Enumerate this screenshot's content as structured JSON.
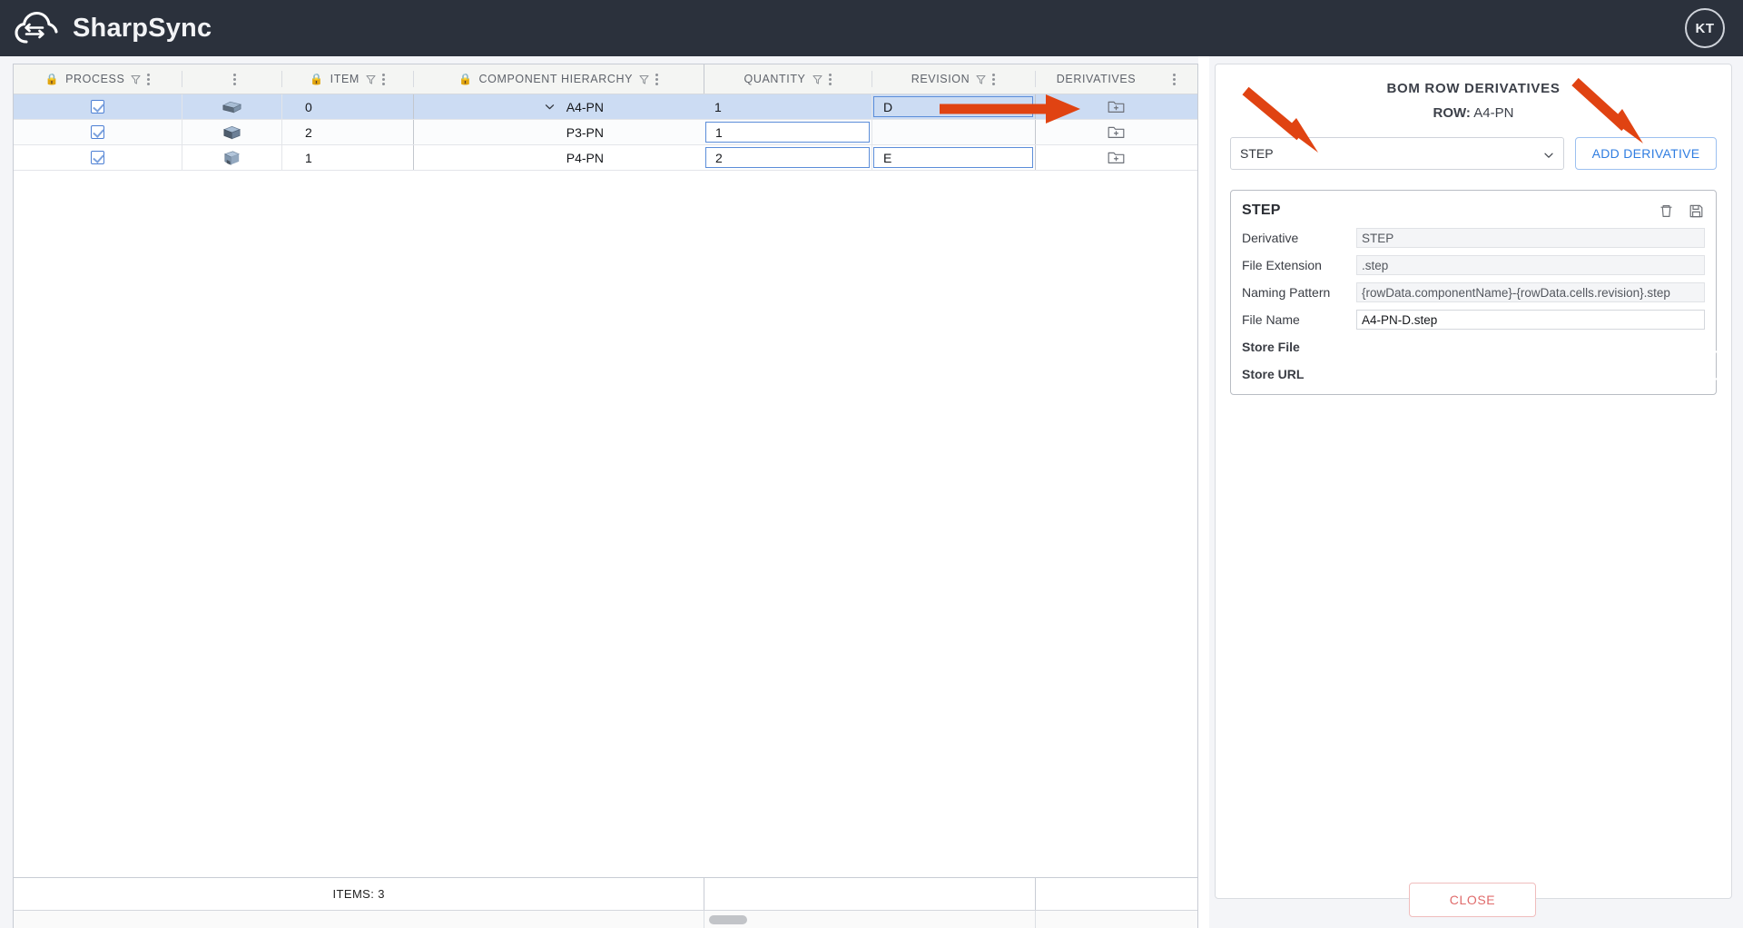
{
  "app": {
    "title": "SharpSync",
    "logo_icon": "cloud-sync-icon",
    "avatar_initials": "KT"
  },
  "grid": {
    "columns": [
      {
        "key": "process",
        "label": "PROCESS",
        "locked": true,
        "filter": true,
        "menu": true
      },
      {
        "key": "thumb",
        "label": "",
        "locked": false,
        "filter": false,
        "menu": true
      },
      {
        "key": "item",
        "label": "ITEM",
        "locked": true,
        "filter": true,
        "menu": true
      },
      {
        "key": "component",
        "label": "COMPONENT HIERARCHY",
        "locked": true,
        "filter": true,
        "menu": true
      },
      {
        "key": "quantity",
        "label": "QUANTITY",
        "locked": false,
        "filter": true,
        "menu": true
      },
      {
        "key": "revision",
        "label": "REVISION",
        "locked": false,
        "filter": true,
        "menu": true
      },
      {
        "key": "deriv",
        "label": "DERIVATIVES",
        "locked": false,
        "filter": false,
        "menu": true
      }
    ],
    "rows": [
      {
        "process_checked": true,
        "thumb_icon": "part-cube-icon",
        "item": "0",
        "component": "A4-PN",
        "indent": 0,
        "expander": "chevron-down-icon",
        "quantity": "1",
        "revision": "D",
        "deriv_icon": "folder-plus-icon",
        "selected": true
      },
      {
        "process_checked": true,
        "thumb_icon": "part-cube-icon",
        "item": "2",
        "component": "P3-PN",
        "indent": 1,
        "expander": "",
        "quantity": "1",
        "revision": "",
        "deriv_icon": "folder-plus-icon",
        "selected": false
      },
      {
        "process_checked": true,
        "thumb_icon": "part-cube-icon",
        "item": "1",
        "component": "P4-PN",
        "indent": 1,
        "expander": "",
        "quantity": "2",
        "revision": "E",
        "deriv_icon": "folder-plus-icon",
        "selected": false
      }
    ],
    "footer": {
      "items_label": "ITEMS: 3"
    }
  },
  "panel": {
    "title": "BOM ROW DERIVATIVES",
    "row_prefix": "ROW:",
    "row_value": "A4-PN",
    "derivative_select": {
      "value": "STEP",
      "chevron": "chevron-down-icon"
    },
    "add_button": "ADD DERIVATIVE",
    "step_card": {
      "title": "STEP",
      "delete_icon": "trash-icon",
      "save_icon": "save-icon",
      "fields": [
        {
          "label": "Derivative",
          "value": "STEP",
          "editable": false
        },
        {
          "label": "File Extension",
          "value": ".step",
          "editable": false
        },
        {
          "label": "Naming Pattern",
          "value": "{rowData.componentName}-{rowData.cells.revision}.step",
          "editable": false
        },
        {
          "label": "File Name",
          "value": "A4-PN-D.step",
          "editable": true
        }
      ],
      "toggles": [
        {
          "label": "Store File",
          "checked": true
        },
        {
          "label": "Store URL",
          "checked": true
        }
      ]
    },
    "close_button": "CLOSE"
  },
  "annotations": {
    "arrow_color": "#e04312",
    "arrows": [
      {
        "name": "arrow-to-derivatives-cell"
      },
      {
        "name": "arrow-to-derivative-select"
      },
      {
        "name": "arrow-to-add-derivative-button"
      }
    ]
  },
  "colors": {
    "topbar": "#2b313c",
    "selection": "#ccdcf3",
    "accent_blue": "#2f7de1",
    "close_red": "#e06b6b",
    "annotation": "#e04312"
  }
}
